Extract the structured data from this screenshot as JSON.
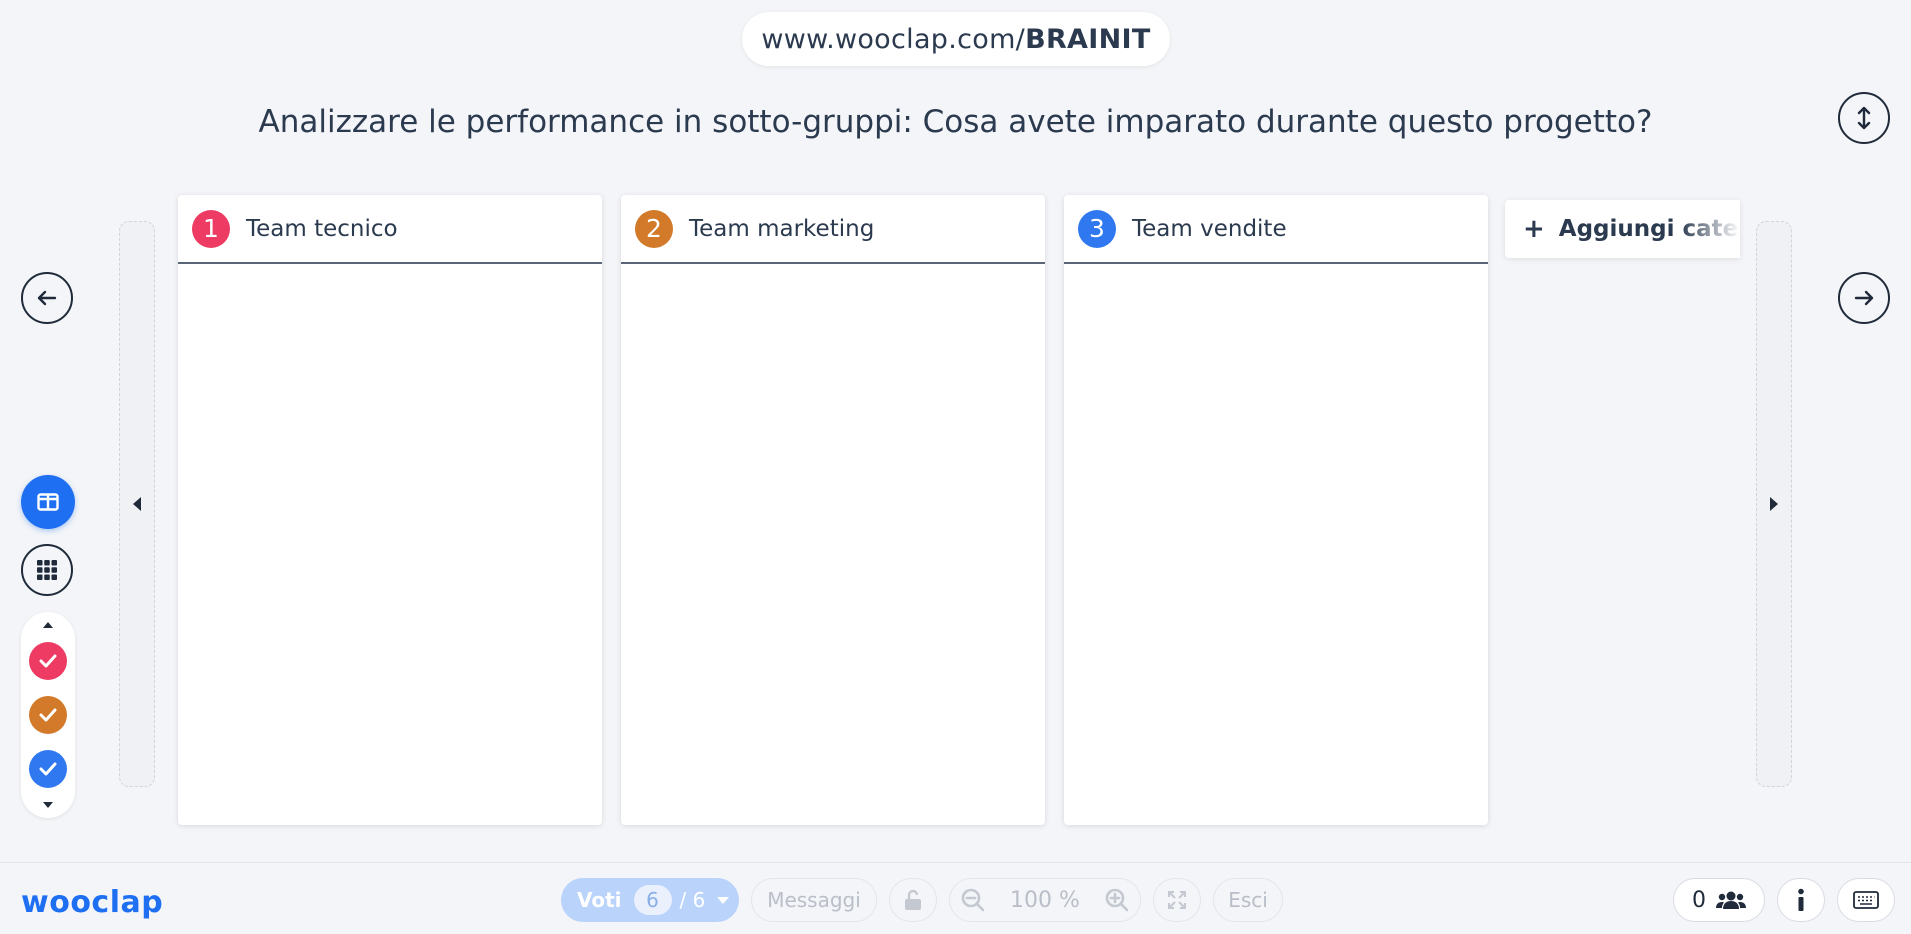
{
  "url": {
    "prefix": "www.wooclap.com/",
    "code": "BRAINIT"
  },
  "question": "Analizzare le performance in sotto-gruppi: Cosa avete imparato durante questo progetto?",
  "columns": [
    {
      "number": "1",
      "title": "Team tecnico",
      "color": "#ee3b63"
    },
    {
      "number": "2",
      "title": "Team marketing",
      "color": "#d27a2a"
    },
    {
      "number": "3",
      "title": "Team vendite",
      "color": "#2f78f0"
    }
  ],
  "add_category": {
    "icon": "+",
    "label": "Aggiungi catego"
  },
  "filters": [
    {
      "color": "#ee3b63"
    },
    {
      "color": "#d27a2a"
    },
    {
      "color": "#2f78f0"
    }
  ],
  "footer": {
    "logo": "wooclap",
    "voti_label": "Voti",
    "voti_count": "6",
    "voti_total": "/ 6",
    "messaggi": "Messaggi",
    "zoom_value": "100 %",
    "esci": "Esci",
    "participants": "0"
  },
  "colors": {
    "accent": "#1e6ff2",
    "text": "#2b3a4f",
    "background": "#f4f5f8"
  }
}
